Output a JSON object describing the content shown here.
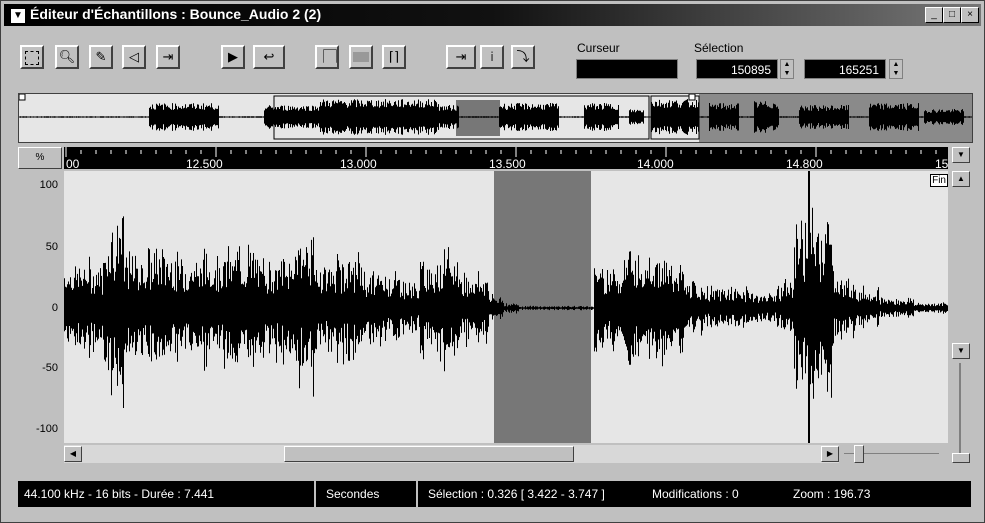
{
  "window": {
    "title": "Éditeur d'Échantillons : Bounce_Audio 2 (2)",
    "minimize": "_",
    "maximize": "□",
    "close": "×"
  },
  "toolbar": {
    "tools": [
      "select-tool",
      "zoom-tool",
      "pencil-tool",
      "speaker-tool",
      "scrub-tool"
    ],
    "play_label": "▶",
    "loop_label": "↩",
    "cursor_label": "Curseur",
    "cursor_value": "",
    "selection_label": "Sélection",
    "selection_start": "150895",
    "selection_end": "165251"
  },
  "ruler": {
    "percent_label": "%",
    "ticks": [
      "00",
      "12.500",
      "13.000",
      "13.500",
      "14.000",
      "14.800",
      "15"
    ]
  },
  "waveform": {
    "y_labels": [
      "100",
      "50",
      "0",
      "-50",
      "-100"
    ],
    "end_marker": "Fin"
  },
  "status": {
    "format": "44.100 kHz - 16 bits - Durée : 7.441",
    "units": "Secondes",
    "selection": "Sélection : 0.326 [ 3.422 - 3.747 ]",
    "modifications": "Modifications : 0",
    "zoom": "Zoom : 196.73"
  },
  "colors": {
    "waveform": "#000000",
    "background": "#e6e6e6",
    "selection": "#777777",
    "titlebar": "#000000"
  }
}
